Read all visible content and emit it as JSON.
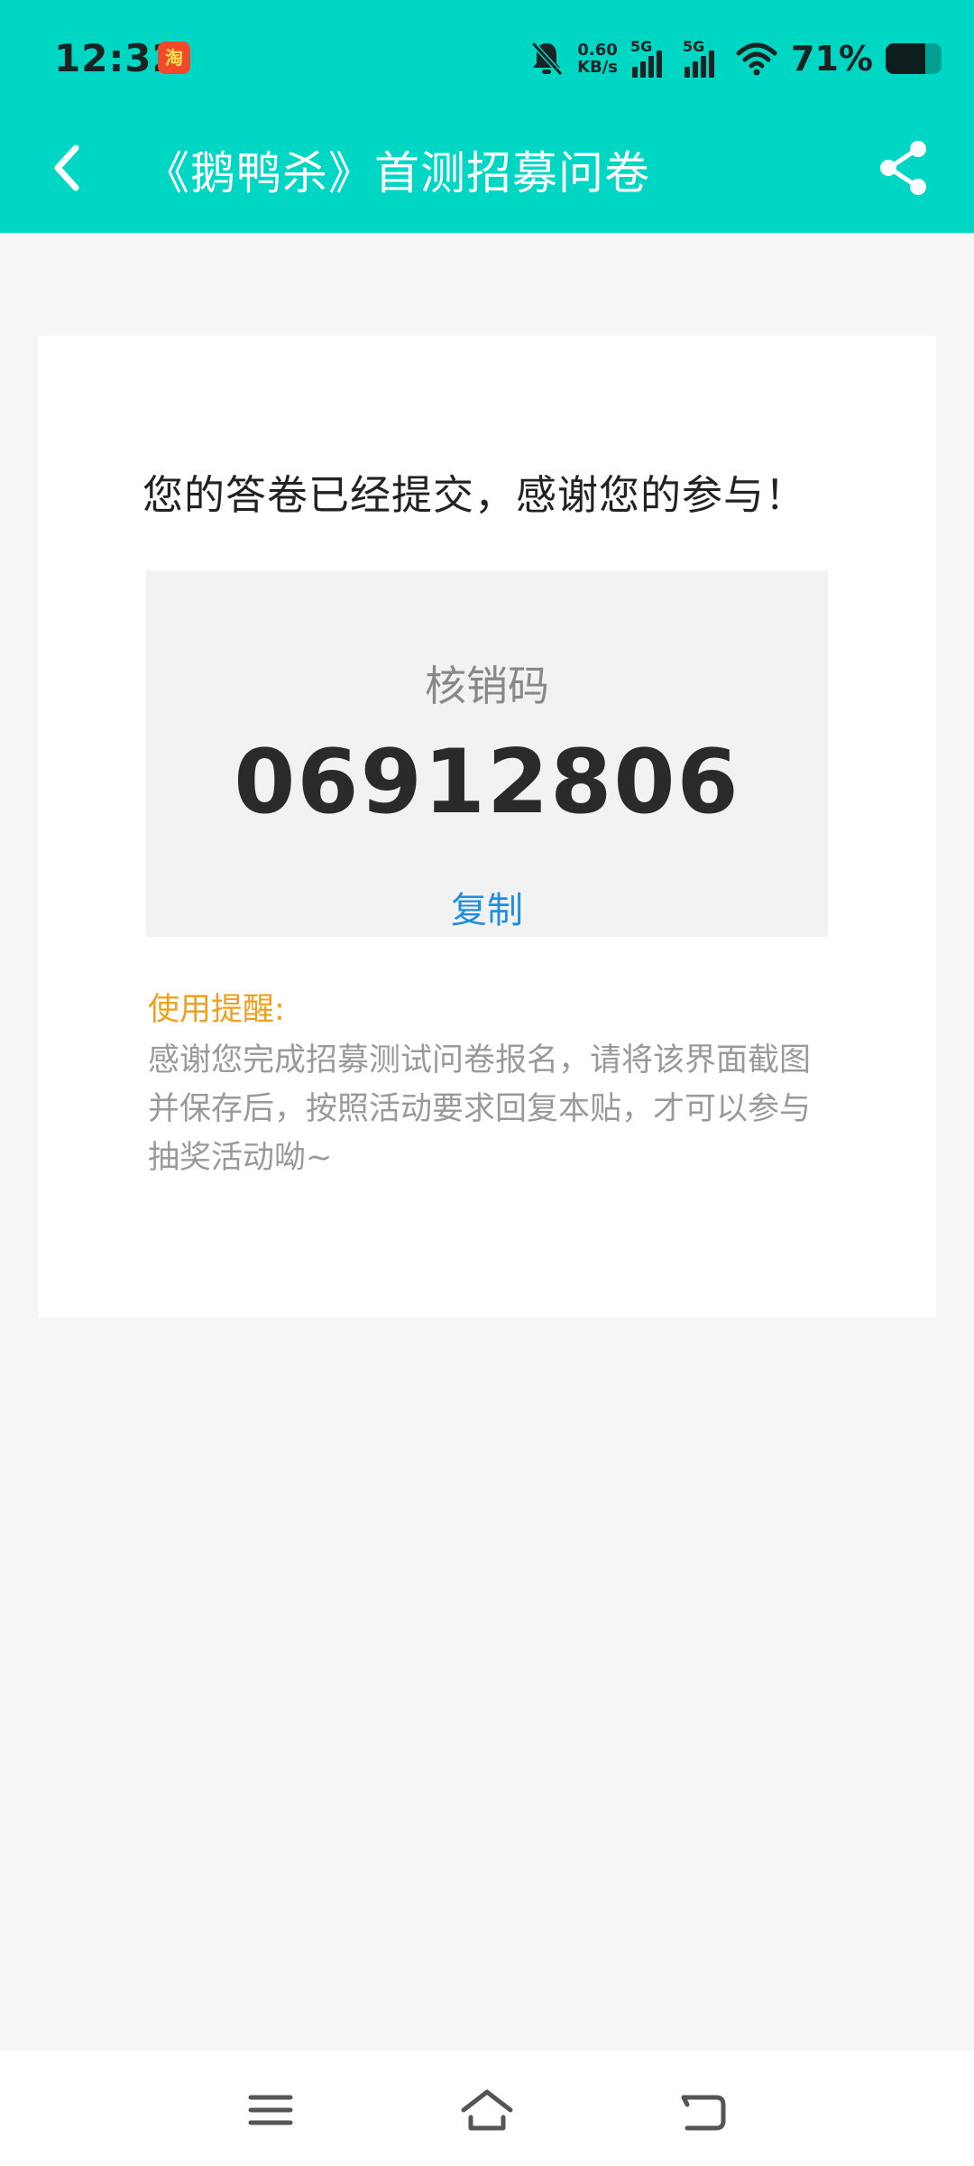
{
  "status_bar": {
    "time": "12:32",
    "app_badge": "淘",
    "net_speed_value": "0.60",
    "net_speed_unit": "KB/s",
    "signal_1_label": "5G",
    "signal_2_label": "5G",
    "battery_percent": "71%",
    "battery_level": 0.71,
    "icons": [
      "bell-muted-icon",
      "signal-icon",
      "signal-icon",
      "wifi-icon",
      "battery-icon"
    ]
  },
  "nav_bar": {
    "title": "《鹅鸭杀》首测招募问卷",
    "back_icon": "chevron-left-icon",
    "share_icon": "share-icon"
  },
  "card": {
    "thanks_message": "您的答卷已经提交，感谢您的参与！",
    "code_label": "核销码",
    "code_value": "06912806",
    "copy_label": "复制",
    "reminder_title": "使用提醒:",
    "reminder_text": "感谢您完成招募测试问卷报名，请将该界面截图并保存后，按照活动要求回复本贴，才可以参与抽奖活动呦~"
  },
  "bottom_nav": {
    "icons": [
      "menu-icon",
      "home-icon",
      "back-icon"
    ]
  },
  "colors": {
    "header_bg": "#00d6c4",
    "page_bg": "#f6f6f6",
    "code_box_bg": "#f2f2f2",
    "copy_link": "#1e8fe0",
    "reminder_title": "#f0a020"
  }
}
